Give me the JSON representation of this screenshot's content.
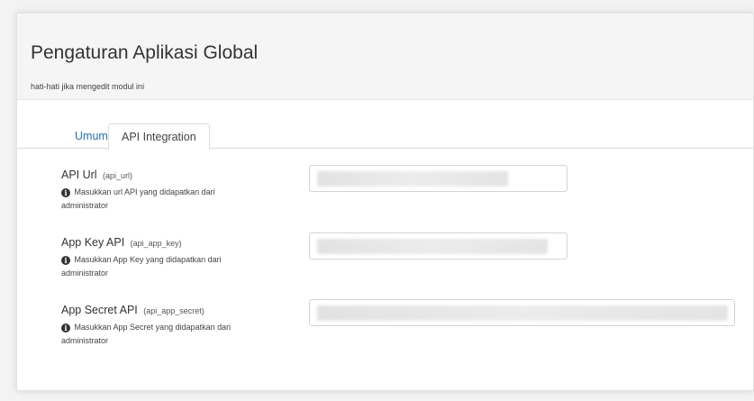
{
  "header": {
    "title": "Pengaturan Aplikasi Global",
    "subtitle": "hati-hati jika mengedit modul ini"
  },
  "tabs": [
    {
      "label": "Umum",
      "active": false
    },
    {
      "label": "API Integration",
      "active": true
    }
  ],
  "fields": [
    {
      "label": "API Url",
      "key": "(api_url)",
      "help_line1": "Masukkan url API yang didapatkan dari",
      "help_line2": "administrator",
      "value": ""
    },
    {
      "label": "App Key API",
      "key": "(api_app_key)",
      "help_line1": "Masukkan App Key yang didapatkan dari",
      "help_line2": "administrator",
      "value": ""
    },
    {
      "label": "App Secret API",
      "key": "(api_app_secret)",
      "help_line1": "Masukkan App Secret yang didapatkan dari",
      "help_line2": "administrator",
      "value": ""
    }
  ],
  "icons": {
    "help": "info-circle-icon"
  },
  "colors": {
    "active_tab_link": "#2a6fad",
    "heading_bg": "#f5f5f5"
  }
}
